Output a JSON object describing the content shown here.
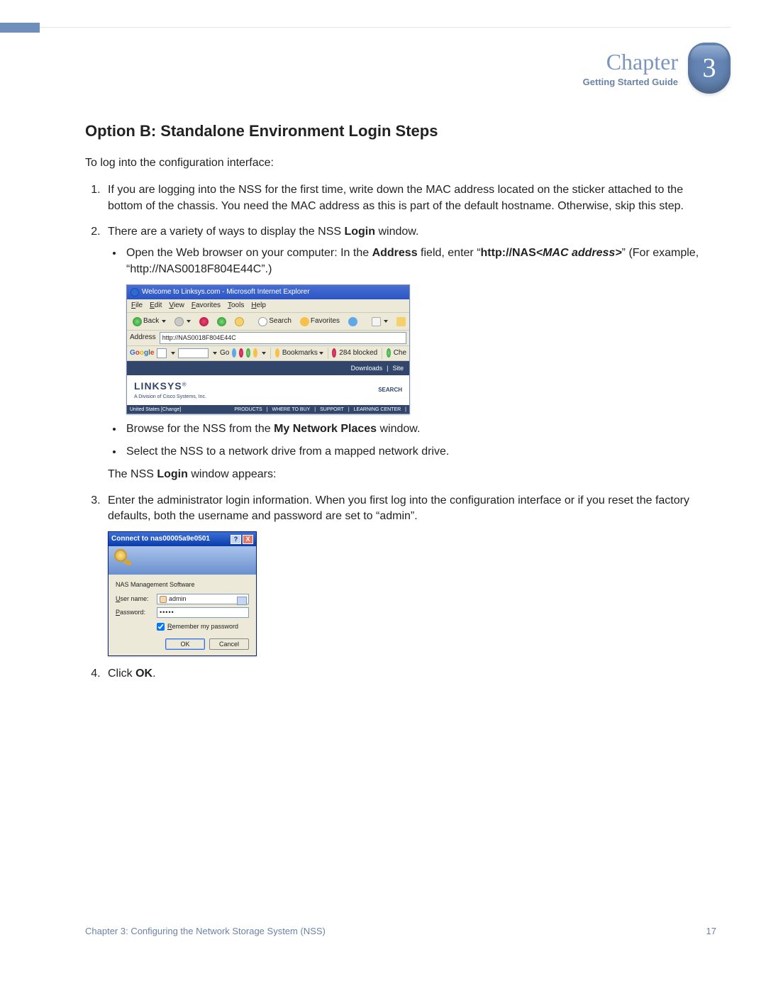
{
  "header": {
    "chapter_label": "Chapter",
    "guide_label": "Getting Started Guide",
    "chapter_num": "3"
  },
  "section_heading": "Option B: Standalone Environment Login Steps",
  "intro": "To log into the configuration interface:",
  "steps": {
    "s1": "If you are logging into the NSS for the first time, write down the MAC address located on the sticker attached to the bottom of the chassis. You need the MAC address as this is part of the default hostname. Otherwise, skip this step.",
    "s2_pre": "There are a variety of ways to display the NSS ",
    "s2_bold": "Login",
    "s2_post": " window.",
    "s2a_pre": "Open the Web browser on your computer: In the ",
    "s2a_b1": "Address",
    "s2a_mid": " field, enter “",
    "s2a_b2": "http://NAS",
    "s2a_bi": "<MAC address>",
    "s2a_post": "” (For example, “http://NAS0018F804E44C”.)",
    "s2b_pre": "Browse for the NSS from the ",
    "s2b_b": "My Network Places",
    "s2b_post": " window.",
    "s2c": "Select the NSS to a network drive from a mapped network drive.",
    "s2_after_pre": "The NSS ",
    "s2_after_b": "Login",
    "s2_after_post": " window appears:",
    "s3": "Enter the administrator login information. When you first log into the configuration interface or if you reset the factory defaults, both the username and password are set to “admin”.",
    "s4_pre": "Click ",
    "s4_b": "OK",
    "s4_post": "."
  },
  "ie": {
    "title": "Welcome to Linksys.com - Microsoft Internet Explorer",
    "menus": [
      "File",
      "Edit",
      "View",
      "Favorites",
      "Tools",
      "Help"
    ],
    "back": "Back",
    "search": "Search",
    "favorites": "Favorites",
    "address_label": "Address",
    "address_value": "http://NAS0018F804E44C",
    "google_label": "Google",
    "g_suffix": "G",
    "go": "Go",
    "bookmarks": "Bookmarks",
    "blocked": "284 blocked",
    "check": "Che",
    "downloads": "Downloads",
    "site": "Site",
    "brand": "LINKSYS",
    "brand_sub": "A Division of Cisco Systems, Inc.",
    "search_cap": "SEARCH",
    "loc": "United States [Change]",
    "nav": [
      "PRODUCTS",
      "WHERE TO BUY",
      "SUPPORT",
      "LEARNING CENTER"
    ]
  },
  "dialog": {
    "title": "Connect to nas00005a9e0501",
    "help": "?",
    "close": "X",
    "subtitle": "NAS Management Software",
    "user_label": "User name:",
    "user_value": "admin",
    "pass_label": "Password:",
    "pass_value": "•••••",
    "remember": "Remember my password",
    "ok": "OK",
    "cancel": "Cancel"
  },
  "footer": {
    "left": "Chapter 3: Configuring the Network Storage System (NSS)",
    "right": "17"
  }
}
